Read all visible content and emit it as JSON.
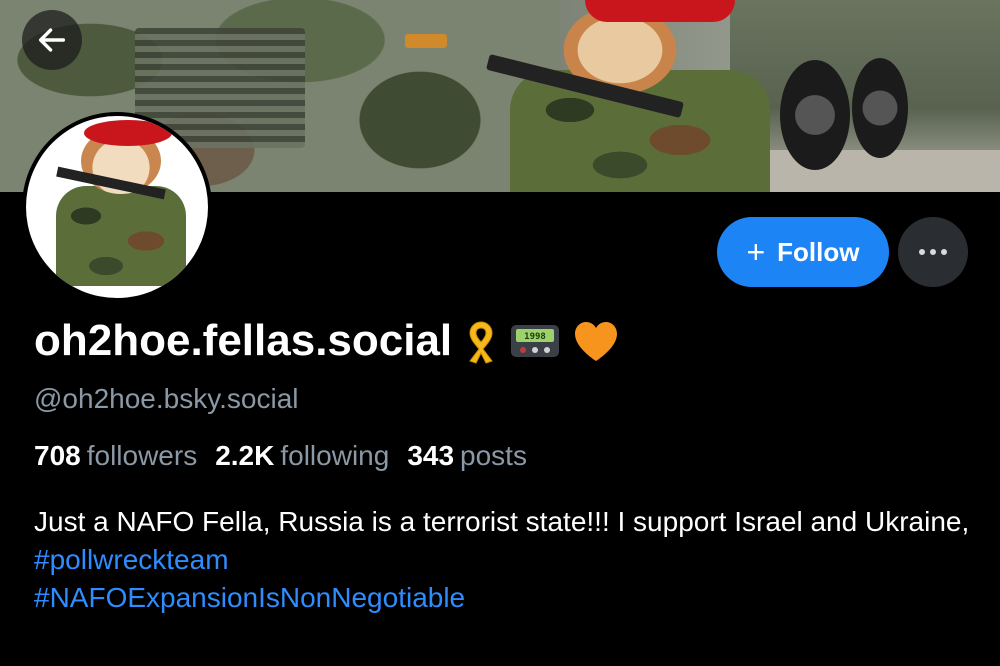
{
  "profile": {
    "display_name": "oh2hoe.fellas.social",
    "handle": "@oh2hoe.bsky.social",
    "name_emojis": [
      "yellow-ribbon-icon",
      "pager-icon",
      "orange-heart-icon"
    ],
    "pager_text": "1998"
  },
  "actions": {
    "follow_label": "Follow",
    "follow_icon": "plus-icon",
    "more_icon": "ellipsis-icon",
    "back_icon": "arrow-left-icon"
  },
  "stats": {
    "followers_count": "708",
    "followers_label": "followers",
    "following_count": "2.2K",
    "following_label": "following",
    "posts_count": "343",
    "posts_label": "posts"
  },
  "bio": {
    "text": "Just a NAFO Fella, Russia is a terrorist state!!! I support Israel and Ukraine,",
    "hashtags": [
      "#pollwreckteam",
      "#NAFOExpansionIsNonNegotiable"
    ]
  },
  "colors": {
    "background": "#000000",
    "accent": "#1d84f5",
    "muted_text": "#8b98a5",
    "link": "#2f8cff"
  }
}
